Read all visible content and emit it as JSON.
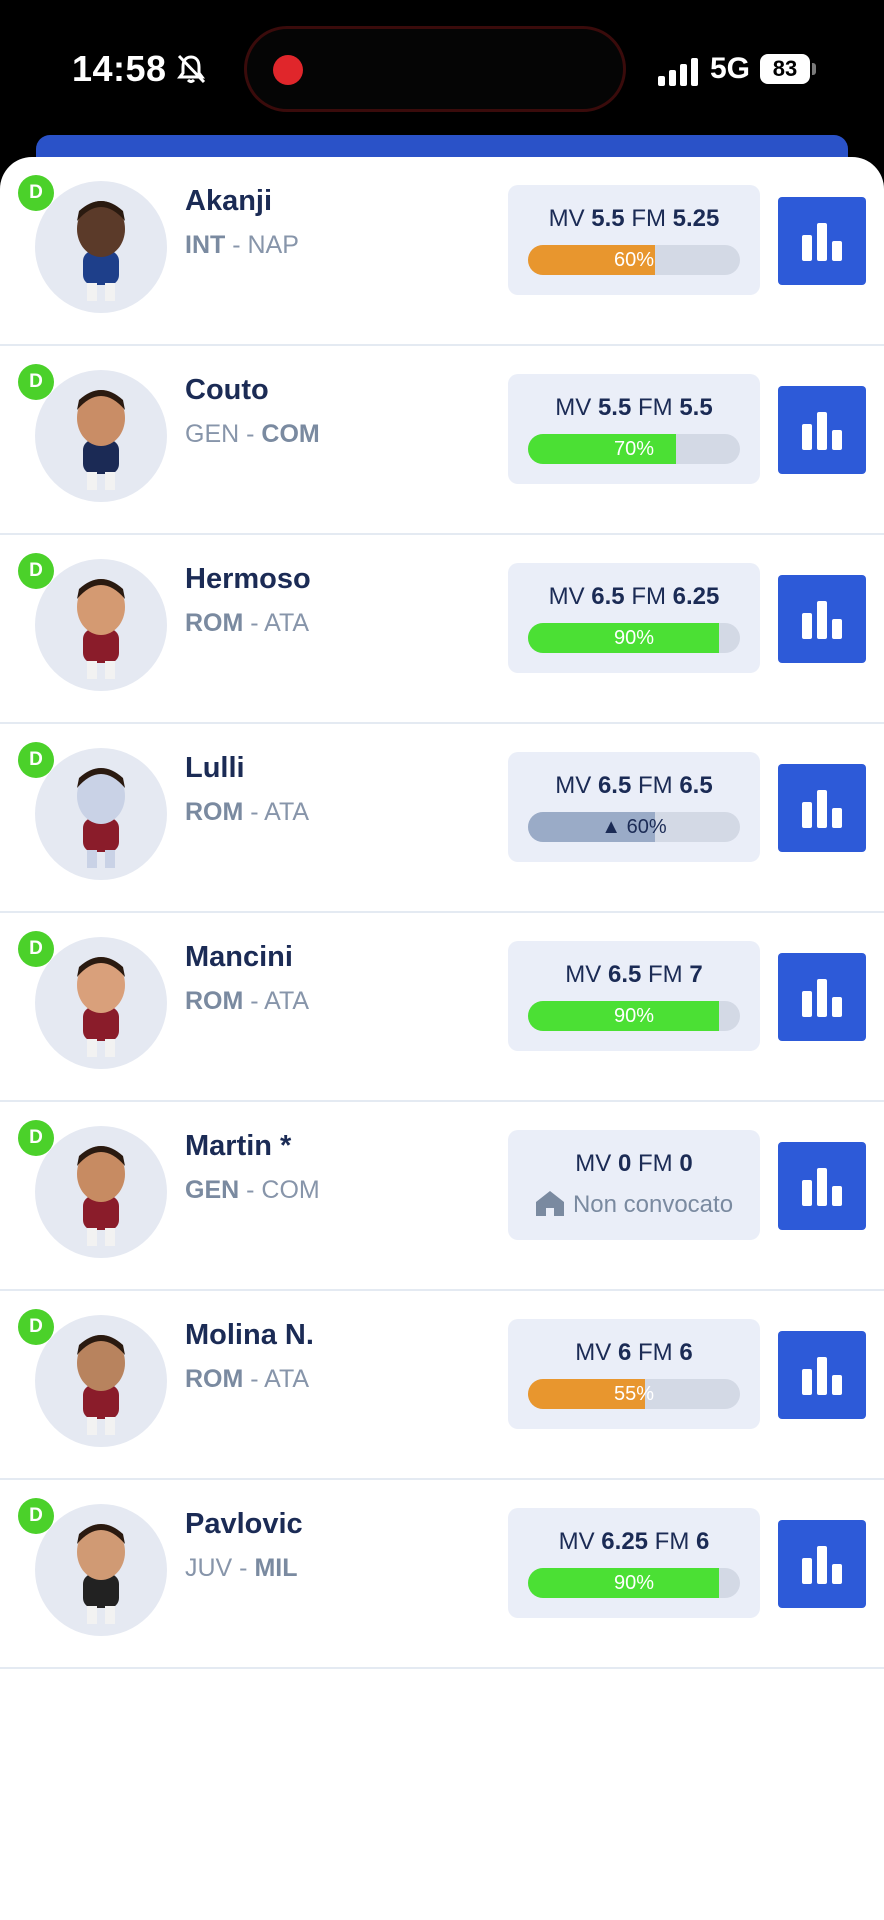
{
  "status_bar": {
    "time": "14:58",
    "network": "5G",
    "battery": "83"
  },
  "colors": {
    "accent": "#2d5ad8",
    "badge": "#4bd12a",
    "bar_green": "#4be034",
    "bar_orange": "#e8962e",
    "bar_gray": "#9aabc7"
  },
  "players": [
    {
      "role": "D",
      "name": "Akanji",
      "team1": "INT",
      "team2": "NAP",
      "strong": 1,
      "mv_label": "MV",
      "mv": "5.5",
      "fm_label": "FM",
      "fm": "5.25",
      "percent": 60,
      "percent_label": "60%",
      "bar_color": "#e8962e"
    },
    {
      "role": "D",
      "name": "Couto",
      "team1": "GEN",
      "team2": "COM",
      "strong": 2,
      "mv_label": "MV",
      "mv": "5.5",
      "fm_label": "FM",
      "fm": "5.5",
      "percent": 70,
      "percent_label": "70%",
      "bar_color": "#4be034"
    },
    {
      "role": "D",
      "name": "Hermoso",
      "team1": "ROM",
      "team2": "ATA",
      "strong": 1,
      "mv_label": "MV",
      "mv": "6.5",
      "fm_label": "FM",
      "fm": "6.25",
      "percent": 90,
      "percent_label": "90%",
      "bar_color": "#4be034"
    },
    {
      "role": "D",
      "name": "Lulli",
      "team1": "ROM",
      "team2": "ATA",
      "strong": 1,
      "mv_label": "MV",
      "mv": "6.5",
      "fm_label": "FM",
      "fm": "6.5",
      "percent": 60,
      "percent_label": "▲ 60%",
      "bar_color": "#9aabc7",
      "label_dark": true
    },
    {
      "role": "D",
      "name": "Mancini",
      "team1": "ROM",
      "team2": "ATA",
      "strong": 1,
      "mv_label": "MV",
      "mv": "6.5",
      "fm_label": "FM",
      "fm": "7",
      "percent": 90,
      "percent_label": "90%",
      "bar_color": "#4be034"
    },
    {
      "role": "D",
      "name": "Martin *",
      "team1": "GEN",
      "team2": "COM",
      "strong": 1,
      "mv_label": "MV",
      "mv": "0",
      "fm_label": "FM",
      "fm": "0",
      "status": "Non convocato",
      "status_icon": "home-icon"
    },
    {
      "role": "D",
      "name": "Molina N.",
      "team1": "ROM",
      "team2": "ATA",
      "strong": 1,
      "mv_label": "MV",
      "mv": "6",
      "fm_label": "FM",
      "fm": "6",
      "percent": 55,
      "percent_label": "55%",
      "bar_color": "#e8962e"
    },
    {
      "role": "D",
      "name": "Pavlovic",
      "team1": "JUV",
      "team2": "MIL",
      "strong": 2,
      "mv_label": "MV",
      "mv": "6.25",
      "fm_label": "FM",
      "fm": "6",
      "percent": 90,
      "percent_label": "90%",
      "bar_color": "#4be034"
    }
  ]
}
